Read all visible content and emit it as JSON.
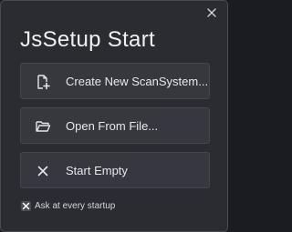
{
  "dialog": {
    "title": "JsSetup Start",
    "close_icon": "close-icon"
  },
  "actions": [
    {
      "label": "Create New ScanSystem...",
      "icon": "new-file-icon"
    },
    {
      "label": "Open From File...",
      "icon": "folder-open-icon"
    },
    {
      "label": "Start Empty",
      "icon": "x-icon"
    }
  ],
  "startup": {
    "label": "Ask at every startup",
    "checked": true,
    "icon": "checkmark-x-icon"
  },
  "colors": {
    "background": "#2b2c32",
    "button": "#37383f",
    "text": "#e6e6ea"
  }
}
